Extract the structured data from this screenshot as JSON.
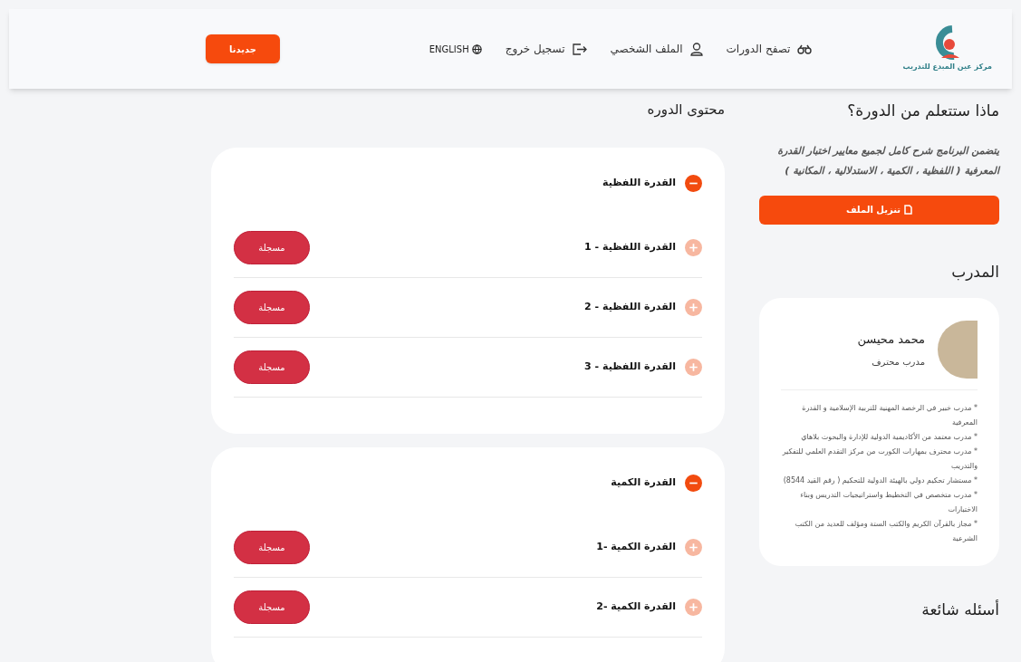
{
  "header": {
    "logo_text": "مركز عين المبدع للتدريب",
    "nav": [
      {
        "kind": "courses",
        "label": "تصفح الدورات"
      },
      {
        "kind": "profile",
        "label": "الملف الشخصي"
      },
      {
        "kind": "logout",
        "label": "تسجيل خروج"
      },
      {
        "kind": "language",
        "label": "ENGLISH"
      }
    ],
    "button": "جديدنا"
  },
  "learn": {
    "title": "ماذا ستتعلم من الدورة؟",
    "description": "يتضمن البرنامج شرح كامل لجميع معايير اختبار القدرة المعرفية ( اللفظية ، الكمية ، الاستدلالية ، المكانية )",
    "download_button": "تنزيل الملف"
  },
  "trainer": {
    "title": "المدرب",
    "name": "محمد محيسن",
    "role": "مدرب محترف",
    "bio": [
      "* مدرب خبير في الرخصة المهنية للتربية الإسلامية و القدرة المعرفية",
      "* مدرب معتمد من الأكاديمية الدولية للإدارة والبحوث بلاهاي",
      "* مدرب محترف بمهارات الكورت من مركز التقدم العلمي للتفكير والتدريب",
      "* مستشار تحكيم دولي بالهيئة الدولية للتحكيم ( رقم القيد 8544)",
      "* مدرب متخصص في التخطيط واستراتيجيات التدريس وبناء الاختبارات",
      "* مجاز بالقرآن الكريم والكتب الستة ومؤلف للعديد من الكتب الشرعية"
    ]
  },
  "faq": {
    "title": "أسئله شائعة"
  },
  "content": {
    "title": "محتوى الدوره",
    "sections": [
      {
        "title": "القدرة اللفظية",
        "expanded": true,
        "items": [
          {
            "title": "القدرة اللفظية - 1",
            "expanded": false,
            "button": "مسجلة"
          },
          {
            "title": "القدرة اللفظية - 2",
            "expanded": false,
            "button": "مسجلة"
          },
          {
            "title": "القدرة اللفظية - 3",
            "expanded": false,
            "button": "مسجلة"
          }
        ]
      },
      {
        "title": "القدرة الكمية",
        "expanded": true,
        "items": [
          {
            "title": "القدرة الكمية -1",
            "expanded": false,
            "button": "مسجلة"
          },
          {
            "title": "القدرة الكمية -2",
            "expanded": false,
            "button": "مسجلة"
          }
        ]
      }
    ]
  }
}
